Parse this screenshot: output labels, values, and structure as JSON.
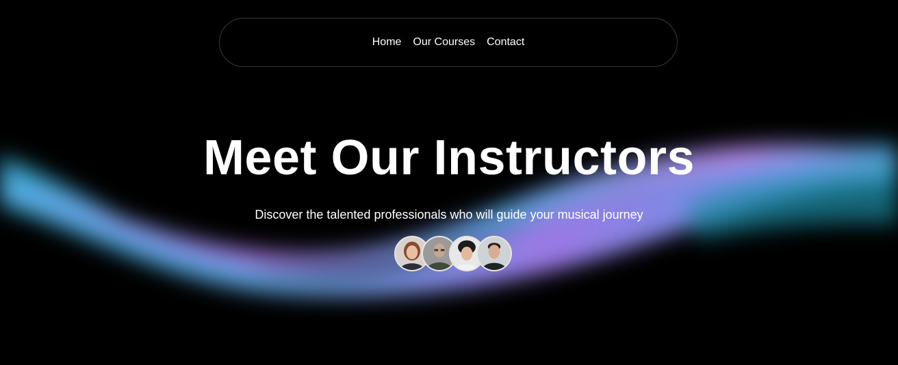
{
  "nav": {
    "items": [
      {
        "label": "Home"
      },
      {
        "label": "Our Courses"
      },
      {
        "label": "Contact"
      }
    ]
  },
  "hero": {
    "title": "Meet Our Instructors",
    "subtitle": "Discover the talented professionals who will guide your musical journey"
  },
  "instructors": [
    {
      "photo": "woman-portrait"
    },
    {
      "photo": "man-with-glasses-portrait"
    },
    {
      "photo": "woman-curly-hair-portrait"
    },
    {
      "photo": "young-man-portrait"
    }
  ],
  "colors": {
    "background": "#000000",
    "wave_cyan": "#2fb6d6",
    "wave_blue": "#5fa8ee",
    "wave_purple": "#b07df0",
    "text": "#ffffff"
  }
}
